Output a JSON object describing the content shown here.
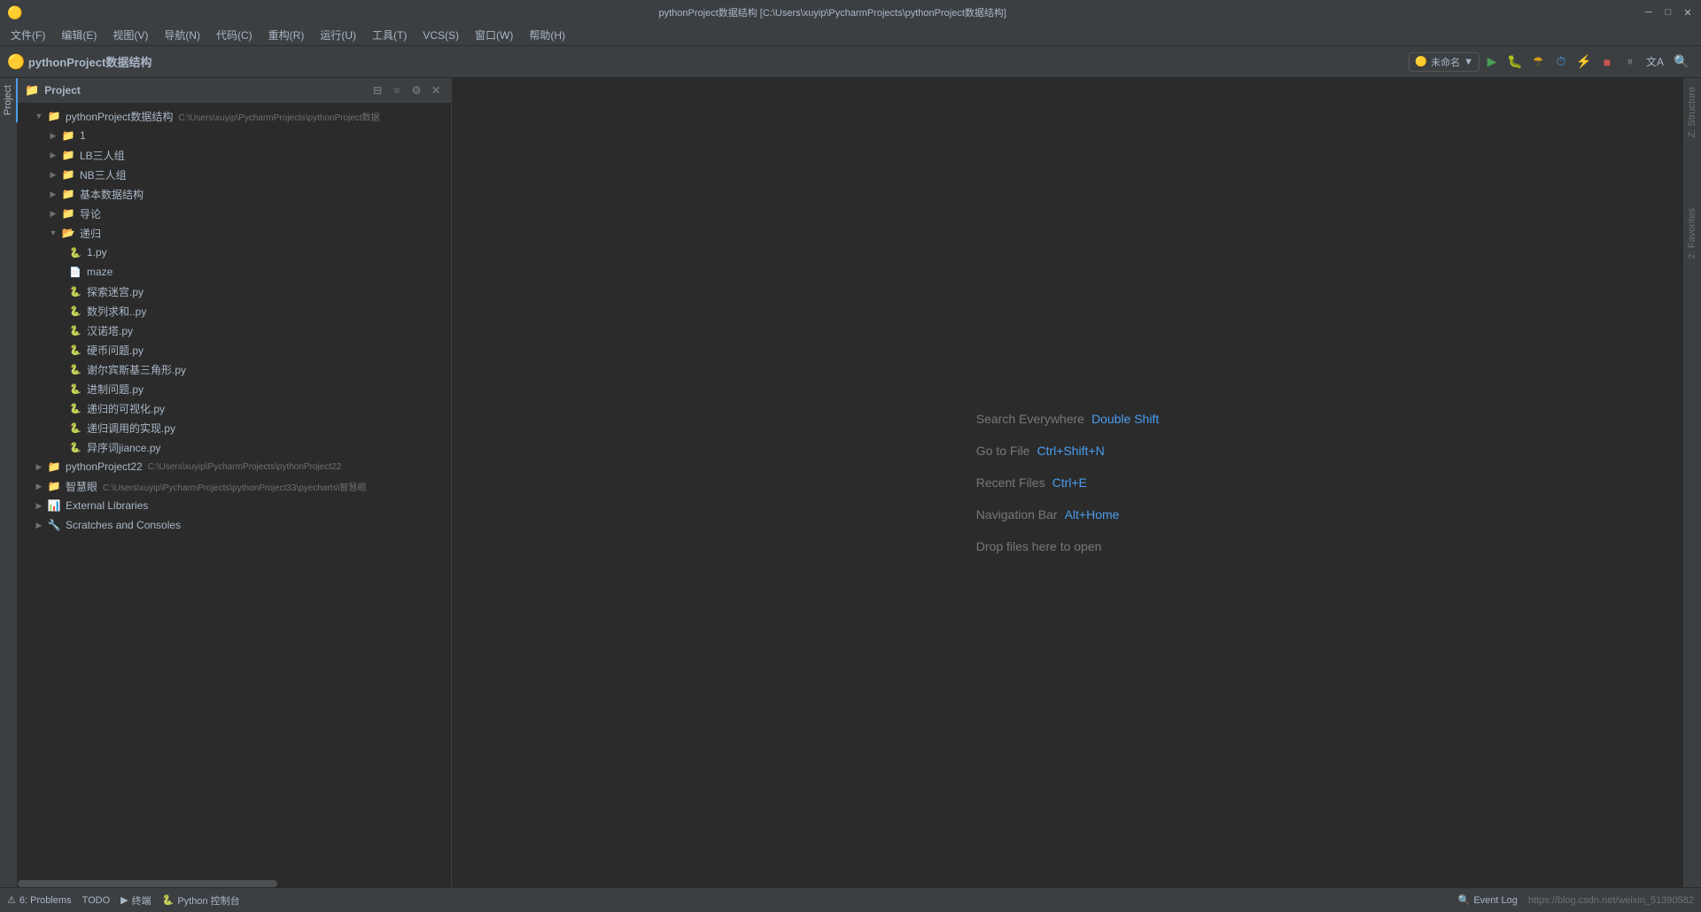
{
  "titlebar": {
    "title": "pythonProject数据结构 [C:\\Users\\xuyip\\PycharmProjects\\pythonProject数据结构]",
    "min_btn": "─",
    "max_btn": "□",
    "close_btn": "✕"
  },
  "menubar": {
    "items": [
      "文件(F)",
      "编辑(E)",
      "视图(V)",
      "导航(N)",
      "代码(C)",
      "重构(R)",
      "运行(U)",
      "工具(T)",
      "VCS(S)",
      "窗口(W)",
      "帮助(H)"
    ]
  },
  "toolbar": {
    "project_icon": "🟡",
    "project_name": "pythonProject数据结构",
    "run_config_name": "未命名",
    "run_config_icon": "▼"
  },
  "project_panel": {
    "title": "Project",
    "root": {
      "name": "pythonProject数据结构",
      "path": "C:\\Users\\xuyip\\PycharmProjects\\pythonProject数据结构",
      "expanded": true,
      "children": [
        {
          "type": "folder",
          "name": "1",
          "expanded": false,
          "indent": 1
        },
        {
          "type": "folder",
          "name": "LB三人组",
          "expanded": false,
          "indent": 1
        },
        {
          "type": "folder",
          "name": "NB三人组",
          "expanded": false,
          "indent": 1
        },
        {
          "type": "folder",
          "name": "基本数据结构",
          "expanded": false,
          "indent": 1
        },
        {
          "type": "folder",
          "name": "导论",
          "expanded": false,
          "indent": 1
        },
        {
          "type": "folder",
          "name": "递归",
          "expanded": true,
          "indent": 1
        },
        {
          "type": "py",
          "name": "1.py",
          "indent": 3
        },
        {
          "type": "file",
          "name": "maze",
          "indent": 3
        },
        {
          "type": "py",
          "name": "探索迷宫.py",
          "indent": 3
        },
        {
          "type": "py",
          "name": "数列求和..py",
          "indent": 3
        },
        {
          "type": "py",
          "name": "汉诺塔.py",
          "indent": 3
        },
        {
          "type": "py",
          "name": "硬币问题.py",
          "indent": 3
        },
        {
          "type": "py",
          "name": "谢尔宾斯基三角形.py",
          "indent": 3
        },
        {
          "type": "py",
          "name": "进制问题.py",
          "indent": 3
        },
        {
          "type": "py",
          "name": "递归的可视化.py",
          "indent": 3
        },
        {
          "type": "py",
          "name": "递归调用的实现.py",
          "indent": 3
        },
        {
          "type": "py",
          "name": "异序词jiance.py",
          "indent": 3
        }
      ]
    },
    "projects": [
      {
        "type": "project",
        "name": "pythonProject22",
        "path": "C:\\Users\\xuyip\\PycharmProjects\\pythonProject22",
        "indent": 0
      },
      {
        "type": "project",
        "name": "智慧眼",
        "path": "C:\\Users\\xuyip\\PycharmProjects\\pythonProject33\\pyecharts\\智慧眼",
        "indent": 0
      }
    ],
    "external_libraries": "External Libraries",
    "scratches": "Scratches and Consoles"
  },
  "editor": {
    "hints": [
      {
        "label": "Search Everywhere",
        "shortcut": "Double Shift"
      },
      {
        "label": "Go to File",
        "shortcut": "Ctrl+Shift+N"
      },
      {
        "label": "Recent Files",
        "shortcut": "Ctrl+E"
      },
      {
        "label": "Navigation Bar",
        "shortcut": "Alt+Home"
      },
      {
        "label": "Drop files here to open",
        "shortcut": ""
      }
    ]
  },
  "bottom_bar": {
    "problems_icon": "⚠",
    "problems_label": "6: Problems",
    "todo_label": "TODO",
    "terminal_icon": "▶",
    "terminal_label": "终端",
    "python_icon": "🐍",
    "python_label": "Python 控制台",
    "event_log_icon": "🔍",
    "event_log_label": "Event Log",
    "status_url": "https://blog.csdn.net/weixin_51390582"
  },
  "side_tabs": {
    "structure_label": "Structure",
    "favorites_label": "2: Favorites"
  },
  "icons": {
    "search": "🔍",
    "gear": "⚙",
    "close": "✕",
    "chevron_down": "▼",
    "chevron_right": "▶",
    "folder": "📁",
    "file": "📄",
    "python": "🐍"
  }
}
